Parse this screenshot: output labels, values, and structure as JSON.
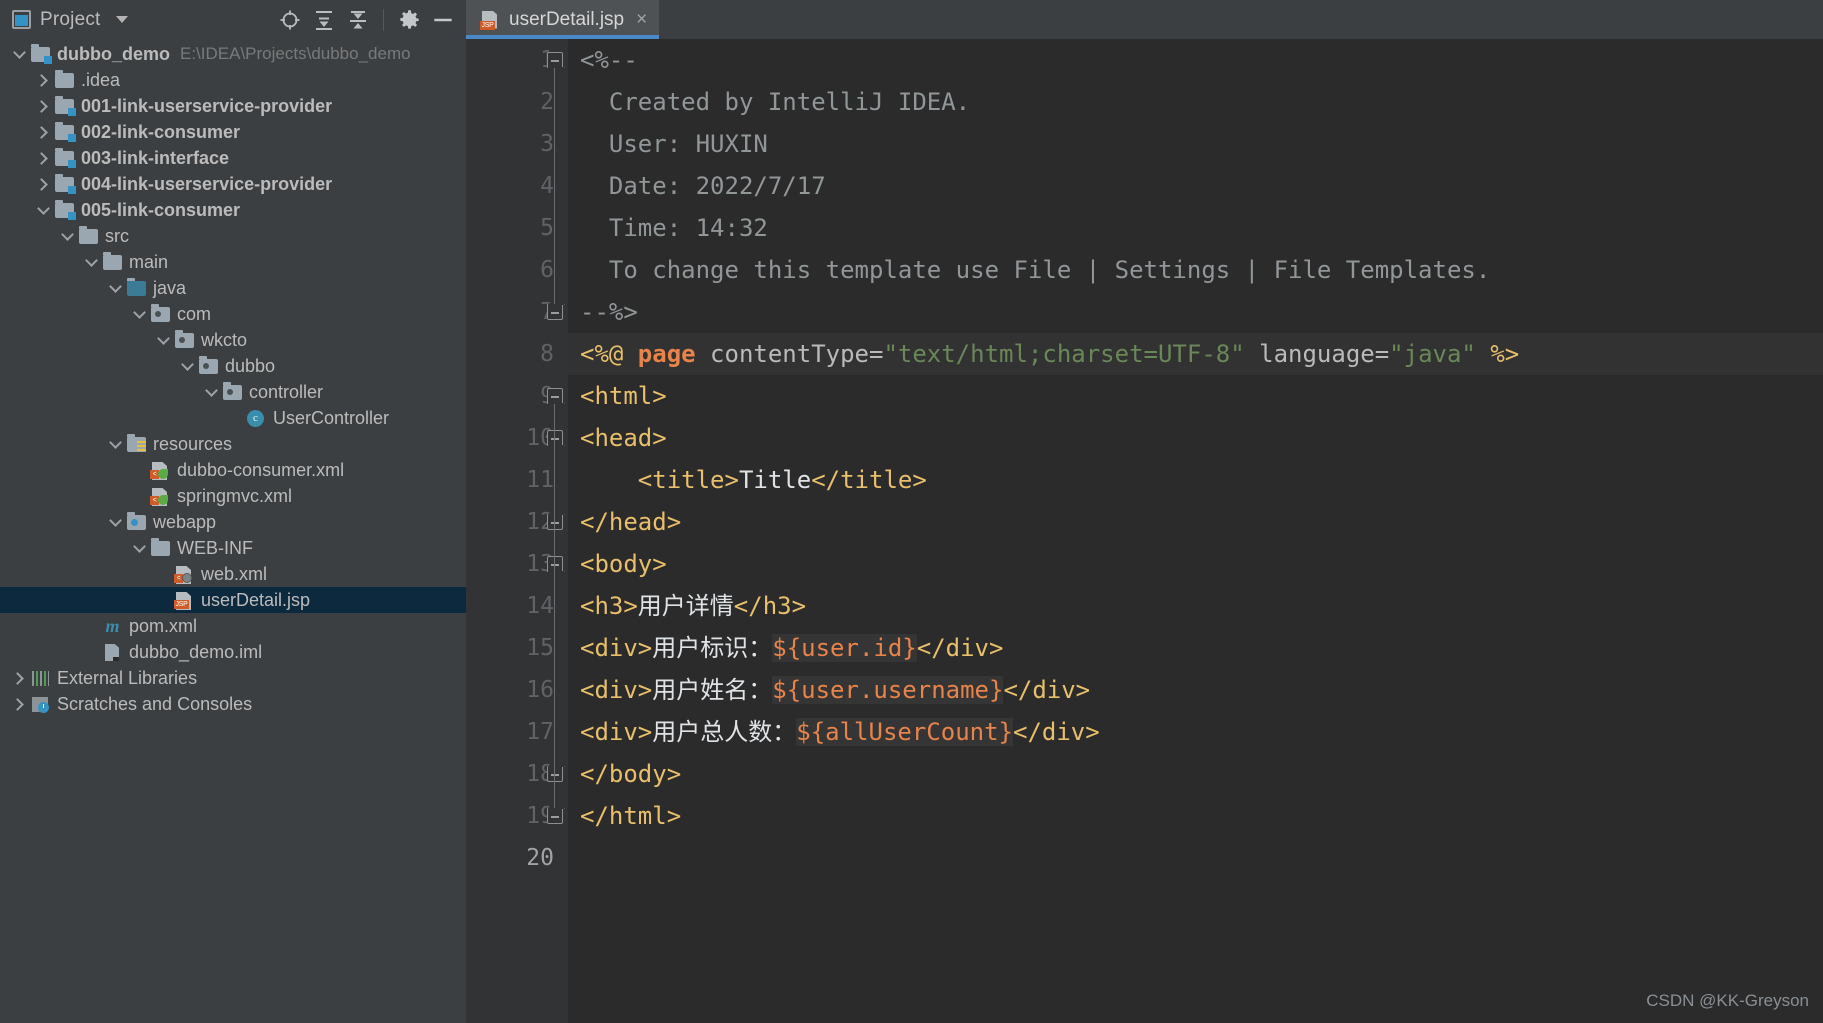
{
  "project_panel": {
    "title": "Project",
    "window_icon": "project-window-icon",
    "dropdown_icon": "chevron-down-icon",
    "actions": [
      {
        "name": "locate-icon",
        "glyph": "⊕"
      },
      {
        "name": "expand-all-icon",
        "glyph": "≡"
      },
      {
        "name": "collapse-all-icon",
        "glyph": "≡"
      },
      {
        "name": "settings-gear-icon",
        "glyph": "⚙"
      },
      {
        "name": "hide-panel-icon",
        "glyph": "—"
      }
    ],
    "tree": [
      {
        "label": "dubbo_demo",
        "path": "E:\\IDEA\\Projects\\dubbo_demo",
        "indent": 0,
        "twisty": "down",
        "icon": "folder-module",
        "bold": true,
        "selected": false
      },
      {
        "label": ".idea",
        "path": "",
        "indent": 1,
        "twisty": "right",
        "icon": "folder",
        "bold": false,
        "selected": false
      },
      {
        "label": "001-link-userservice-provider",
        "path": "",
        "indent": 1,
        "twisty": "right",
        "icon": "folder-module",
        "bold": true,
        "selected": false
      },
      {
        "label": "002-link-consumer",
        "path": "",
        "indent": 1,
        "twisty": "right",
        "icon": "folder-module",
        "bold": true,
        "selected": false
      },
      {
        "label": "003-link-interface",
        "path": "",
        "indent": 1,
        "twisty": "right",
        "icon": "folder-module",
        "bold": true,
        "selected": false
      },
      {
        "label": "004-link-userservice-provider",
        "path": "",
        "indent": 1,
        "twisty": "right",
        "icon": "folder-module",
        "bold": true,
        "selected": false
      },
      {
        "label": "005-link-consumer",
        "path": "",
        "indent": 1,
        "twisty": "down",
        "icon": "folder-module",
        "bold": true,
        "selected": false
      },
      {
        "label": "src",
        "path": "",
        "indent": 2,
        "twisty": "down",
        "icon": "folder",
        "bold": false,
        "selected": false
      },
      {
        "label": "main",
        "path": "",
        "indent": 3,
        "twisty": "down",
        "icon": "folder",
        "bold": false,
        "selected": false
      },
      {
        "label": "java",
        "path": "",
        "indent": 4,
        "twisty": "down",
        "icon": "folder-source",
        "bold": false,
        "selected": false
      },
      {
        "label": "com",
        "path": "",
        "indent": 5,
        "twisty": "down",
        "icon": "folder-package",
        "bold": false,
        "selected": false
      },
      {
        "label": "wkcto",
        "path": "",
        "indent": 6,
        "twisty": "down",
        "icon": "folder-package",
        "bold": false,
        "selected": false
      },
      {
        "label": "dubbo",
        "path": "",
        "indent": 7,
        "twisty": "down",
        "icon": "folder-package",
        "bold": false,
        "selected": false
      },
      {
        "label": "controller",
        "path": "",
        "indent": 8,
        "twisty": "down",
        "icon": "folder-package",
        "bold": false,
        "selected": false
      },
      {
        "label": "UserController",
        "path": "",
        "indent": 9,
        "twisty": "none",
        "icon": "java-class",
        "bold": false,
        "selected": false
      },
      {
        "label": "resources",
        "path": "",
        "indent": 4,
        "twisty": "down",
        "icon": "folder-resources",
        "bold": false,
        "selected": false
      },
      {
        "label": "dubbo-consumer.xml",
        "path": "",
        "indent": 5,
        "twisty": "none",
        "icon": "spring-xml",
        "bold": false,
        "selected": false
      },
      {
        "label": "springmvc.xml",
        "path": "",
        "indent": 5,
        "twisty": "none",
        "icon": "spring-xml",
        "bold": false,
        "selected": false
      },
      {
        "label": "webapp",
        "path": "",
        "indent": 4,
        "twisty": "down",
        "icon": "folder-webapp",
        "bold": false,
        "selected": false
      },
      {
        "label": "WEB-INF",
        "path": "",
        "indent": 5,
        "twisty": "down",
        "icon": "folder",
        "bold": false,
        "selected": false
      },
      {
        "label": "web.xml",
        "path": "",
        "indent": 6,
        "twisty": "none",
        "icon": "web-xml",
        "bold": false,
        "selected": false
      },
      {
        "label": "userDetail.jsp",
        "path": "",
        "indent": 6,
        "twisty": "none",
        "icon": "jsp-file",
        "bold": false,
        "selected": true
      },
      {
        "label": "pom.xml",
        "path": "",
        "indent": 3,
        "twisty": "none",
        "icon": "maven",
        "bold": false,
        "selected": false
      },
      {
        "label": "dubbo_demo.iml",
        "path": "",
        "indent": 3,
        "twisty": "none",
        "icon": "iml",
        "bold": false,
        "selected": false
      },
      {
        "label": "External Libraries",
        "path": "",
        "indent": 0,
        "twisty": "right",
        "icon": "libraries",
        "bold": false,
        "selected": false
      },
      {
        "label": "Scratches and Consoles",
        "path": "",
        "indent": 0,
        "twisty": "right",
        "icon": "scratches",
        "bold": false,
        "selected": false
      }
    ]
  },
  "editor": {
    "tab": {
      "label": "userDetail.jsp",
      "icon": "jsp-file-icon",
      "close_label": "×",
      "active_color": "#4a88c7"
    },
    "lines": [
      {
        "no": "1",
        "fold": "top",
        "segments": [
          {
            "t": "comment",
            "text": "<%--"
          }
        ]
      },
      {
        "no": "2",
        "fold": "",
        "segments": [
          {
            "t": "comment",
            "text": "  Created by IntelliJ IDEA."
          }
        ]
      },
      {
        "no": "3",
        "fold": "",
        "segments": [
          {
            "t": "comment",
            "text": "  User: HUXIN"
          }
        ]
      },
      {
        "no": "4",
        "fold": "",
        "segments": [
          {
            "t": "comment",
            "text": "  Date: 2022/7/17"
          }
        ]
      },
      {
        "no": "5",
        "fold": "",
        "segments": [
          {
            "t": "comment",
            "text": "  Time: 14:32"
          }
        ]
      },
      {
        "no": "6",
        "fold": "",
        "segments": [
          {
            "t": "comment",
            "text": "  To change this template use File | Settings | File Templates."
          }
        ]
      },
      {
        "no": "7",
        "fold": "bottom",
        "segments": [
          {
            "t": "comment",
            "text": "--%>"
          }
        ]
      },
      {
        "no": "8",
        "fold": "",
        "hl": true,
        "segments": [
          {
            "t": "dir",
            "text": "<%@ "
          },
          {
            "t": "dirname",
            "text": "page"
          },
          {
            "t": "attr",
            "text": " contentType="
          },
          {
            "t": "str",
            "text": "\"text/html;charset=UTF-8\""
          },
          {
            "t": "attr",
            "text": " language="
          },
          {
            "t": "str",
            "text": "\"java\""
          },
          {
            "t": "dir",
            "text": " %>"
          }
        ]
      },
      {
        "no": "9",
        "fold": "top",
        "segments": [
          {
            "t": "tag",
            "text": "<html>"
          }
        ]
      },
      {
        "no": "10",
        "fold": "top",
        "segments": [
          {
            "t": "tag",
            "text": "<head>"
          }
        ]
      },
      {
        "no": "11",
        "fold": "",
        "segments": [
          {
            "t": "tag",
            "text": "    <title>"
          },
          {
            "t": "text",
            "text": "Title"
          },
          {
            "t": "tag",
            "text": "</title>"
          }
        ]
      },
      {
        "no": "12",
        "fold": "bottom",
        "segments": [
          {
            "t": "tag",
            "text": "</head>"
          }
        ]
      },
      {
        "no": "13",
        "fold": "top",
        "segments": [
          {
            "t": "tag",
            "text": "<body>"
          }
        ]
      },
      {
        "no": "14",
        "fold": "",
        "segments": [
          {
            "t": "tag",
            "text": "<h3>"
          },
          {
            "t": "text",
            "text": "用户详情"
          },
          {
            "t": "tag",
            "text": "</h3>"
          }
        ]
      },
      {
        "no": "15",
        "fold": "",
        "segments": [
          {
            "t": "tag",
            "text": "<div>"
          },
          {
            "t": "text",
            "text": "用户标识："
          },
          {
            "t": "el",
            "text": "${user.id}"
          },
          {
            "t": "tag",
            "text": "</div>"
          }
        ]
      },
      {
        "no": "16",
        "fold": "",
        "segments": [
          {
            "t": "tag",
            "text": "<div>"
          },
          {
            "t": "text",
            "text": "用户姓名："
          },
          {
            "t": "el",
            "text": "${user.username}"
          },
          {
            "t": "tag",
            "text": "</div>"
          }
        ]
      },
      {
        "no": "17",
        "fold": "",
        "segments": [
          {
            "t": "tag",
            "text": "<div>"
          },
          {
            "t": "text",
            "text": "用户总人数："
          },
          {
            "t": "el",
            "text": "${allUserCount}"
          },
          {
            "t": "tag",
            "text": "</div>"
          }
        ]
      },
      {
        "no": "18",
        "fold": "bottom",
        "segments": [
          {
            "t": "tag",
            "text": "</body>"
          }
        ]
      },
      {
        "no": "19",
        "fold": "bottom",
        "segments": [
          {
            "t": "tag",
            "text": "</html>"
          }
        ]
      },
      {
        "no": "20",
        "fold": "",
        "current": true,
        "segments": [
          {
            "t": "text",
            "text": ""
          }
        ]
      }
    ]
  },
  "watermark": "CSDN @KK-Greyson"
}
